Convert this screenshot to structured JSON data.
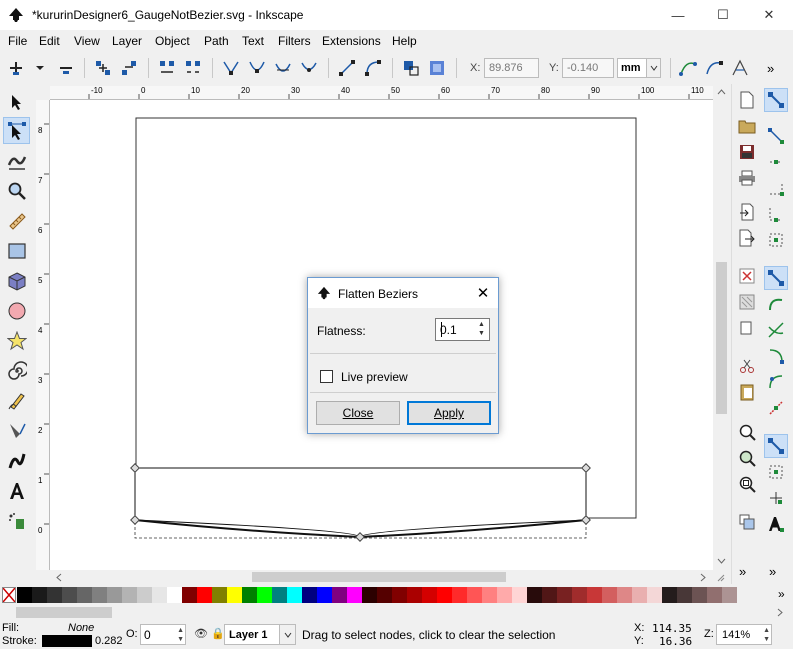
{
  "window": {
    "title": "*kururinDesigner6_GaugeNotBezier.svg - Inkscape",
    "minimize": "—",
    "maximize": "☐",
    "close": "✕"
  },
  "menu": [
    "File",
    "Edit",
    "View",
    "Layer",
    "Object",
    "Path",
    "Text",
    "Filters",
    "Extensions",
    "Help"
  ],
  "toolbar": {
    "x_label": "X:",
    "x_value": "89.876",
    "y_label": "Y:",
    "y_value": "-0.140",
    "unit": "mm",
    "more": "»"
  },
  "rulers": {
    "h_ticks": [
      "-10",
      "0",
      "10",
      "20",
      "30",
      "40",
      "50",
      "60",
      "70",
      "80",
      "90",
      "100",
      "110"
    ],
    "v_ticks": [
      "8",
      "7",
      "6",
      "5",
      "4",
      "3",
      "2",
      "1",
      "0"
    ]
  },
  "dialog": {
    "title": "Flatten Beziers",
    "flatness_label": "Flatness:",
    "flatness_value": "0.1",
    "live_preview_label": "Live preview",
    "live_preview_checked": false,
    "close_button": "Close",
    "apply_button": "Apply"
  },
  "palette": {
    "colors": [
      "#000000",
      "#1a1a1a",
      "#333333",
      "#4d4d4d",
      "#666666",
      "#808080",
      "#999999",
      "#b3b3b3",
      "#cccccc",
      "#e6e6e6",
      "#ffffff",
      "#800000",
      "#ff0000",
      "#808000",
      "#ffff00",
      "#008000",
      "#00ff00",
      "#008080",
      "#00ffff",
      "#000080",
      "#0000ff",
      "#800080",
      "#ff00ff",
      "#2b0000",
      "#550000",
      "#800000",
      "#aa0000",
      "#d40000",
      "#ff0000",
      "#ff2a2a",
      "#ff5555",
      "#ff8080",
      "#ffaaaa",
      "#ffd5d5",
      "#280b0b",
      "#501616",
      "#782121",
      "#a02c2c",
      "#c83737",
      "#d35f5f",
      "#de8787",
      "#e9afaf",
      "#f4d7d7",
      "#241c1c",
      "#483737",
      "#6c5353",
      "#916f6f",
      "#ac9393"
    ]
  },
  "status": {
    "fill_label": "Fill:",
    "fill_value": "None",
    "stroke_label": "Stroke:",
    "stroke_width": "0.282",
    "opacity_label": "O:",
    "opacity_value": "0",
    "layer": "Layer 1",
    "message": "Drag to select nodes, click to clear the selection",
    "cursor_x_label": "X:",
    "cursor_x": "114.35",
    "cursor_y_label": "Y:",
    "cursor_y": "16.36",
    "zoom_label": "Z:",
    "zoom": "141%"
  }
}
